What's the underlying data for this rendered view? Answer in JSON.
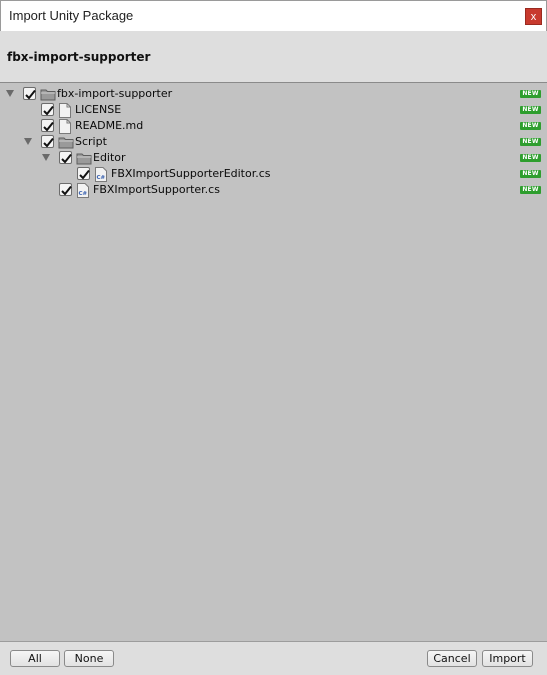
{
  "window": {
    "title": "Import Unity Package",
    "close_label": "x"
  },
  "header": {
    "package_name": "fbx-import-supporter"
  },
  "tree": {
    "badge": "NEW",
    "items": [
      {
        "label": "fbx-import-supporter",
        "type": "folder",
        "checked": true,
        "expanded": true
      },
      {
        "label": "LICENSE",
        "type": "file",
        "checked": true
      },
      {
        "label": "README.md",
        "type": "file",
        "checked": true
      },
      {
        "label": "Script",
        "type": "folder",
        "checked": true,
        "expanded": true
      },
      {
        "label": "Editor",
        "type": "folder",
        "checked": true,
        "expanded": true
      },
      {
        "label": "FBXImportSupporterEditor.cs",
        "type": "cs-script",
        "checked": true
      },
      {
        "label": "FBXImportSupporter.cs",
        "type": "cs-script",
        "checked": true
      }
    ]
  },
  "icons": {
    "folder": "folder-icon",
    "file": "document-icon",
    "script": "csharp-script-icon",
    "check": "checkmark-icon",
    "foldout": "triangle-down-icon"
  },
  "colors": {
    "badge": "#2e9e2e",
    "close": "#c83a2e",
    "panel": "#c2c2c2"
  },
  "footer": {
    "all_label": "All",
    "none_label": "None",
    "cancel_label": "Cancel",
    "import_label": "Import"
  }
}
